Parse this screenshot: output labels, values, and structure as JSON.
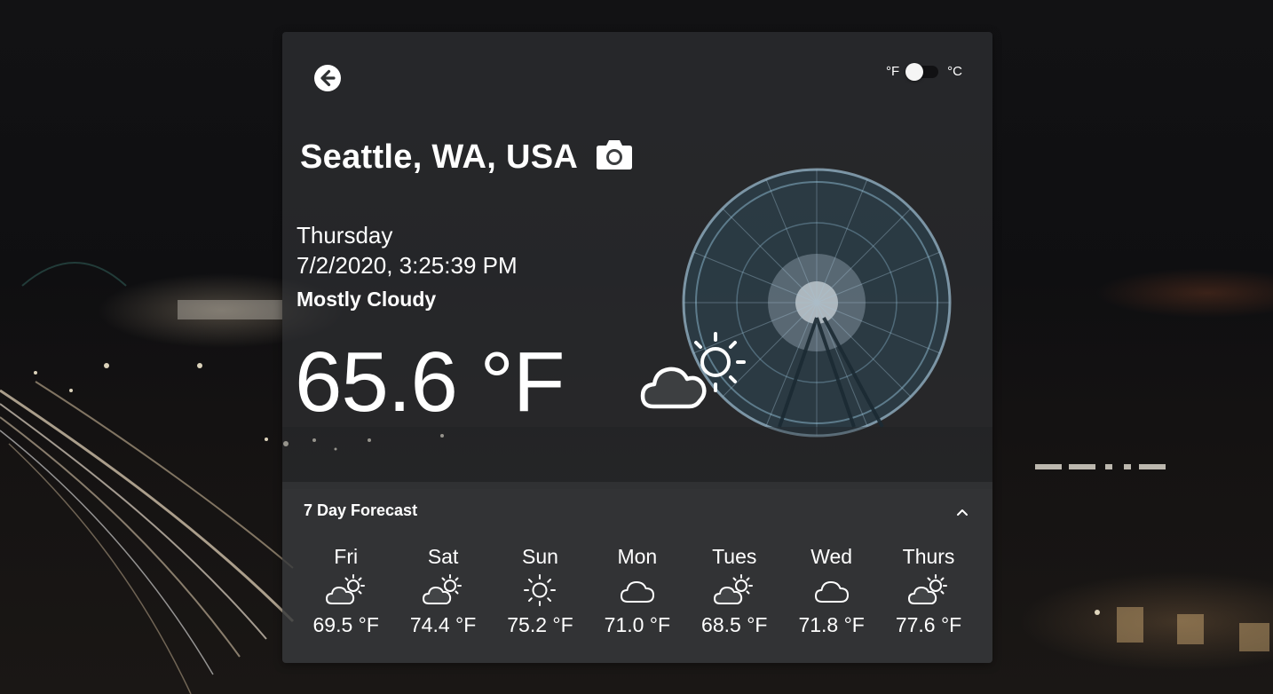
{
  "location": {
    "city": "Seattle, WA, USA"
  },
  "units": {
    "fahrenheit_label": "°F",
    "celsius_label": "°C",
    "selected": "°F"
  },
  "current": {
    "day": "Thursday",
    "datetime": "7/2/2020, 3:25:39 PM",
    "condition": "Mostly Cloudy",
    "temperature": "65.6 °F",
    "icon": "partly-cloudy-icon"
  },
  "forecast": {
    "title": "7 Day Forecast",
    "days": [
      {
        "name": "Fri",
        "temp": "69.5 °F",
        "icon": "partly-cloudy-icon"
      },
      {
        "name": "Sat",
        "temp": "74.4 °F",
        "icon": "partly-cloudy-icon"
      },
      {
        "name": "Sun",
        "temp": "75.2 °F",
        "icon": "sun-icon"
      },
      {
        "name": "Mon",
        "temp": "71.0 °F",
        "icon": "cloud-icon"
      },
      {
        "name": "Tues",
        "temp": "68.5 °F",
        "icon": "partly-cloudy-icon"
      },
      {
        "name": "Wed",
        "temp": "71.8 °F",
        "icon": "cloud-icon"
      },
      {
        "name": "Thurs",
        "temp": "77.6 °F",
        "icon": "partly-cloudy-icon"
      }
    ]
  },
  "colors": {
    "text": "#ffffff",
    "card": "#343638"
  }
}
